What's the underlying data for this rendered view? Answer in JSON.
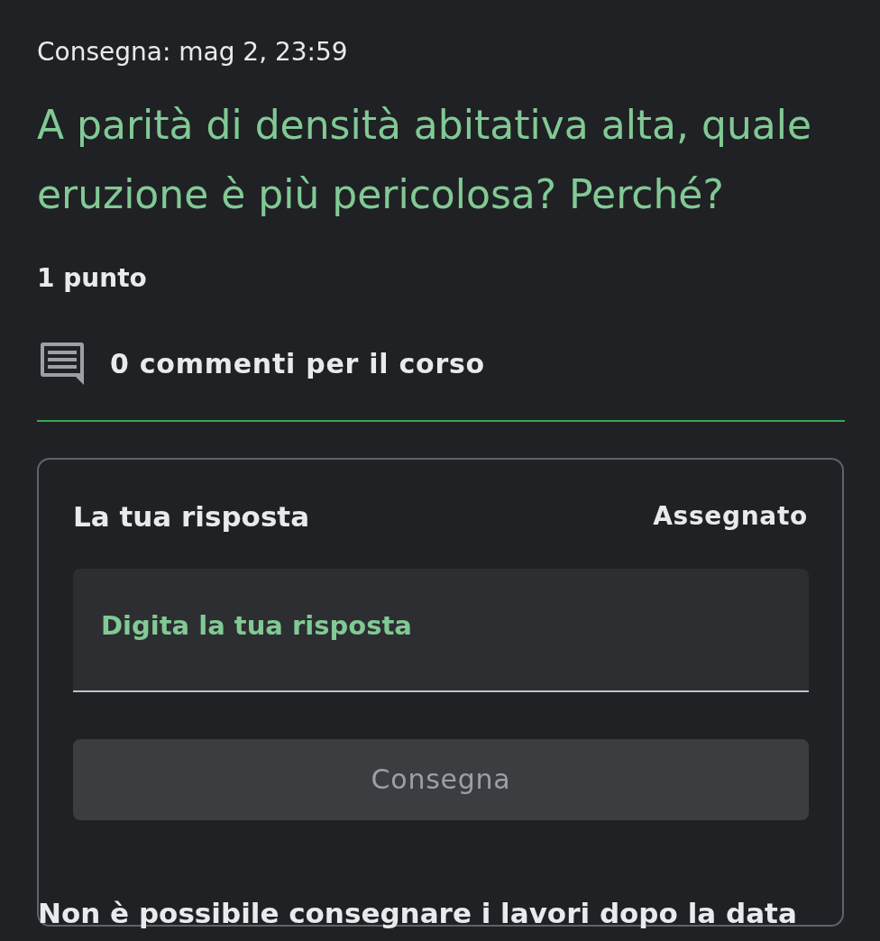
{
  "due_date": "Consegna: mag 2, 23:59",
  "question": "A parità di densità abitativa alta, quale eruzione è più pericolosa? Perché?",
  "points": "1 punto",
  "comments": "0 commenti per il corso",
  "answer_card": {
    "title": "La tua risposta",
    "status": "Assegnato",
    "answer_field": {
      "placeholder": "Digita la tua risposta"
    },
    "submit_button": {
      "label": "Consegna",
      "disabled": true
    }
  },
  "notice": "Non è possibile consegnare i lavori dopo la data"
}
